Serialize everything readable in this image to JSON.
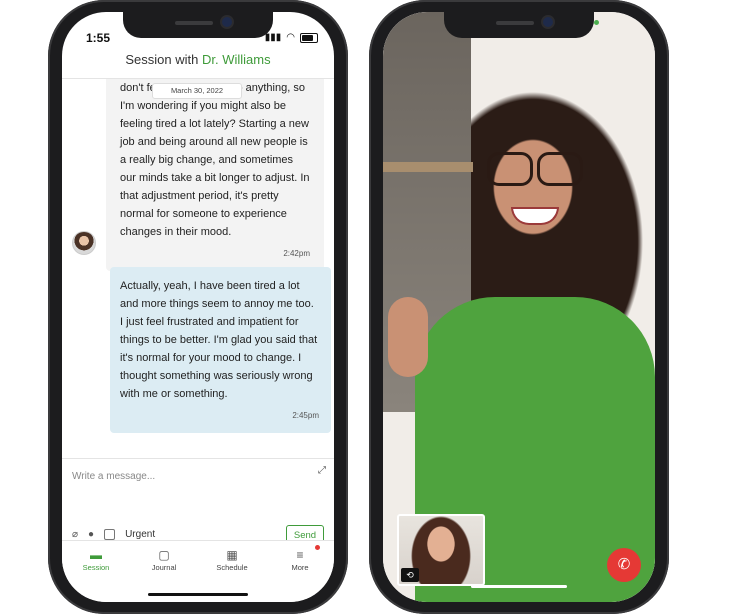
{
  "left_phone": {
    "status": {
      "time": "1:55"
    },
    "header": {
      "prefix": "Session with",
      "doctor": "Dr. Williams"
    },
    "date_chip": "March 30, 2022",
    "messages": [
      {
        "from": "therapist",
        "text": "don't feel motivated to do anything, so I'm wondering if you might also be feeling tired a lot lately? Starting a new job and being around all new people is a really big change, and sometimes our minds take a bit longer to adjust. In that adjustment period, it's pretty normal for someone to experience changes in their mood.",
        "time": "2:42pm"
      },
      {
        "from": "client",
        "text": "Actually, yeah, I have been tired a lot and more things seem to annoy me too. I just feel frustrated and impatient for things to be better. I'm glad you said that it's normal for your mood to change. I thought something was seriously wrong with me or something.",
        "time": "2:45pm"
      }
    ],
    "compose": {
      "placeholder": "Write a message...",
      "urgent_label": "Urgent",
      "send_label": "Send"
    },
    "tabs": [
      {
        "label": "Session",
        "icon": "chat-icon",
        "glyph": "▬",
        "active": true
      },
      {
        "label": "Journal",
        "icon": "journal-icon",
        "glyph": "▢",
        "active": false
      },
      {
        "label": "Schedule",
        "icon": "calendar-icon",
        "glyph": "▦",
        "active": false
      },
      {
        "label": "More",
        "icon": "menu-icon",
        "glyph": "≡",
        "active": false
      }
    ]
  },
  "right_phone": {
    "pip_camera_glyph": "⟲",
    "end_call_glyph": "✆"
  },
  "colors": {
    "accent": "#3f9b3a",
    "client_bubble": "#dcecf3",
    "therapist_bubble": "#f3f3f3",
    "end_call": "#e53935"
  }
}
